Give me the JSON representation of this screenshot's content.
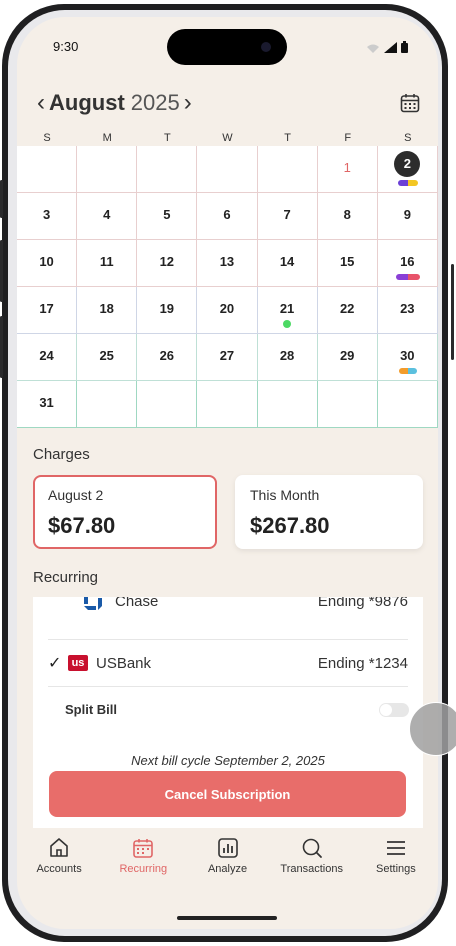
{
  "status_bar": {
    "time": "9:30"
  },
  "header": {
    "month": "August",
    "year": "2025"
  },
  "calendar": {
    "weekdays": [
      "S",
      "M",
      "T",
      "W",
      "T",
      "F",
      "S"
    ],
    "weeks": [
      [
        "",
        "",
        "",
        "",
        "",
        "1",
        "2"
      ],
      [
        "3",
        "4",
        "5",
        "6",
        "7",
        "8",
        "9"
      ],
      [
        "10",
        "11",
        "12",
        "13",
        "14",
        "15",
        "16"
      ],
      [
        "17",
        "18",
        "19",
        "20",
        "21",
        "22",
        "23"
      ],
      [
        "24",
        "25",
        "26",
        "27",
        "28",
        "29",
        "30"
      ],
      [
        "31",
        "",
        "",
        "",
        "",
        "",
        ""
      ]
    ]
  },
  "charges": {
    "title": "Charges",
    "selected_day": {
      "label": "August 2",
      "amount": "$67.80"
    },
    "this_month": {
      "label": "This Month",
      "amount": "$267.80"
    }
  },
  "recurring": {
    "title": "Recurring",
    "banks": [
      {
        "name": "Chase",
        "ending": "Ending *9876",
        "selected": false
      },
      {
        "name": "USBank",
        "ending": "Ending *1234",
        "selected": true
      }
    ],
    "usbank_logo_text": "us",
    "check_mark": "✓",
    "split_bill_label": "Split Bill",
    "next_cycle": "Next bill cycle September 2, 2025",
    "cancel_label": "Cancel Subscription"
  },
  "tabbar": {
    "tabs": [
      {
        "label": "Accounts",
        "icon": "home-icon"
      },
      {
        "label": "Recurring",
        "icon": "calendar-icon",
        "active": true
      },
      {
        "label": "Analyze",
        "icon": "bar-chart-icon"
      },
      {
        "label": "Transactions",
        "icon": "search-icon"
      },
      {
        "label": "Settings",
        "icon": "menu-icon"
      }
    ]
  },
  "colors": {
    "accent": "#e86d6a",
    "background": "#f5efe8",
    "selected_border": "#e06666"
  }
}
